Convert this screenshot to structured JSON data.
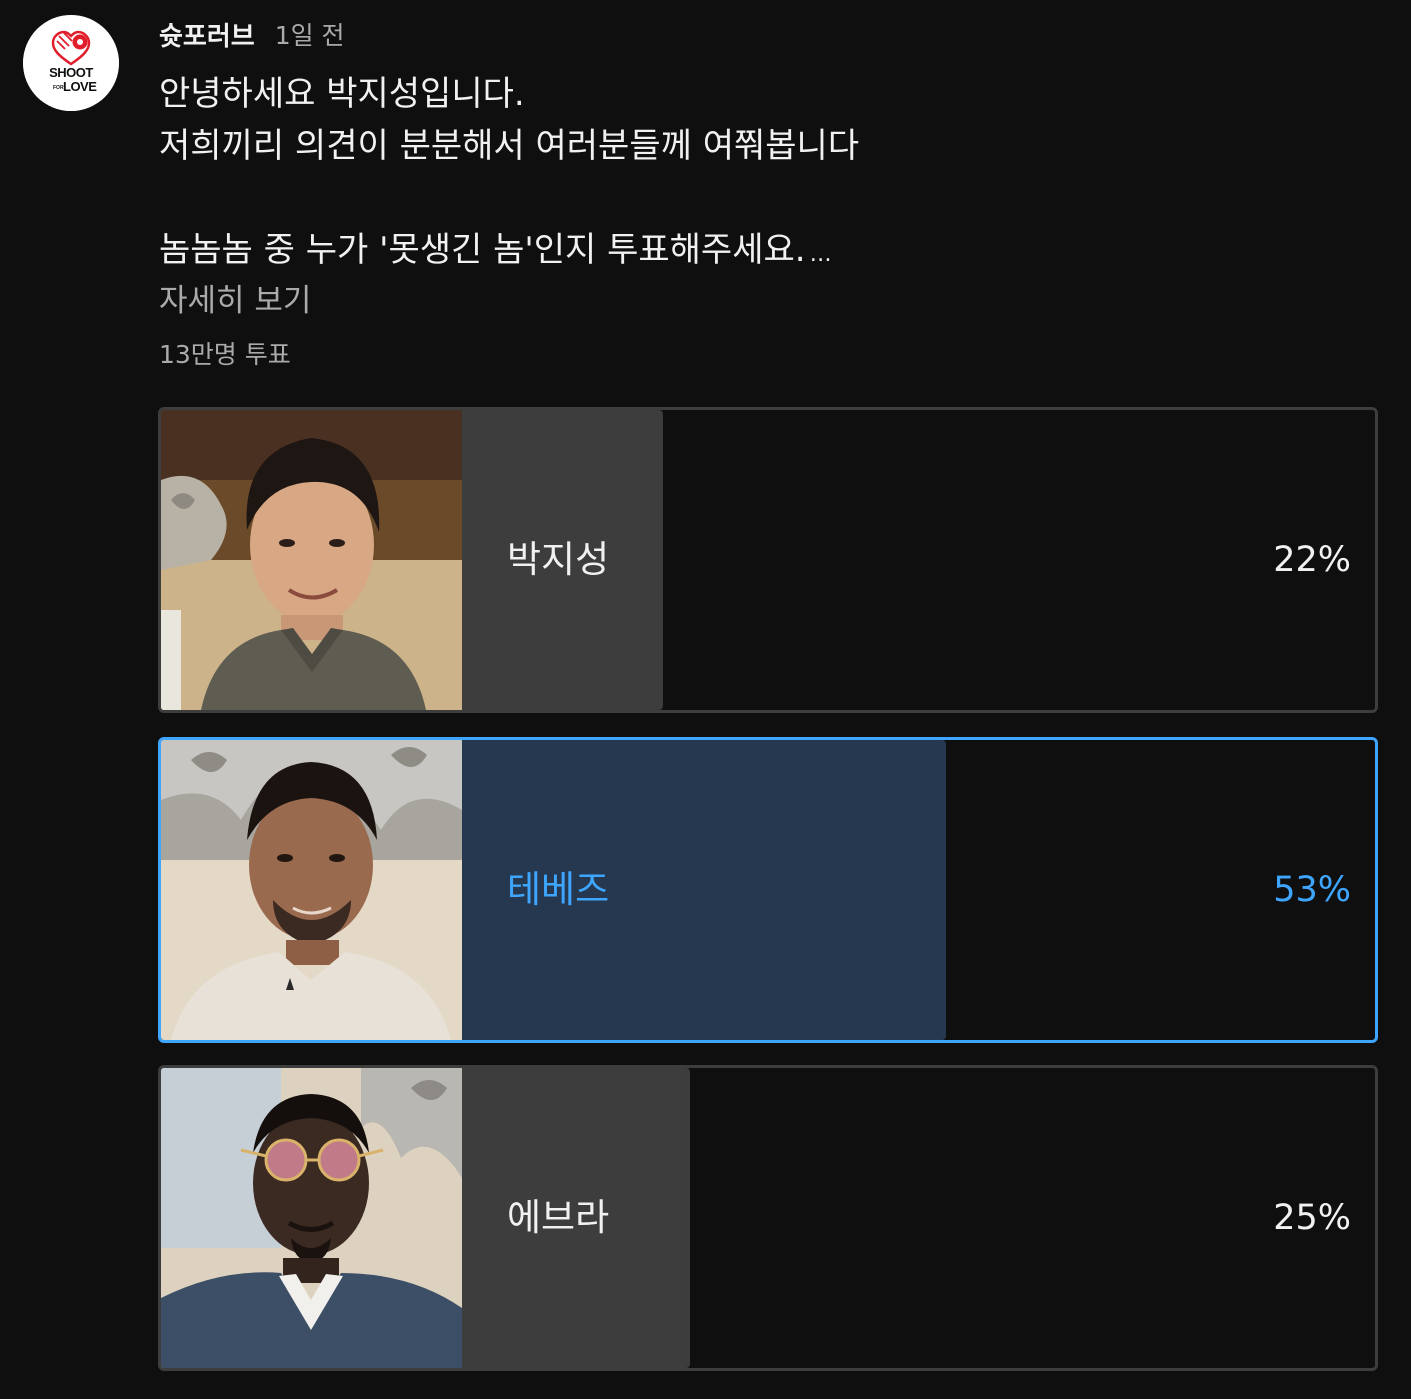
{
  "channel": {
    "name": "슛포러브",
    "time": "1일 전",
    "avatar_icon": "shoot-for-love-logo"
  },
  "post": {
    "lines": [
      "안녕하세요 박지성입니다.",
      "저희끼리 의견이 분분해서 여러분들께 여쭤봅니다",
      "",
      "놈놈놈 중 누가 '못생긴 놈'인지 투표해주세요."
    ],
    "ellipsis": "…",
    "read_more": "자세히 보기"
  },
  "poll": {
    "vote_count": "13만명 투표",
    "options": [
      {
        "label": "박지성",
        "percent_text": "22%",
        "percent": 22,
        "selected": false
      },
      {
        "label": "테베즈",
        "percent_text": "53%",
        "percent": 53,
        "selected": true
      },
      {
        "label": "에브라",
        "percent_text": "25%",
        "percent": 25,
        "selected": false
      }
    ]
  },
  "colors": {
    "background": "#0f0f0f",
    "text_primary": "#f1f1f1",
    "text_secondary": "#aaaaaa",
    "option_border": "#3d3d3d",
    "fill_default": "#3d3d3d",
    "accent_selected": "#3ea6ff",
    "fill_selected": "#263850"
  }
}
